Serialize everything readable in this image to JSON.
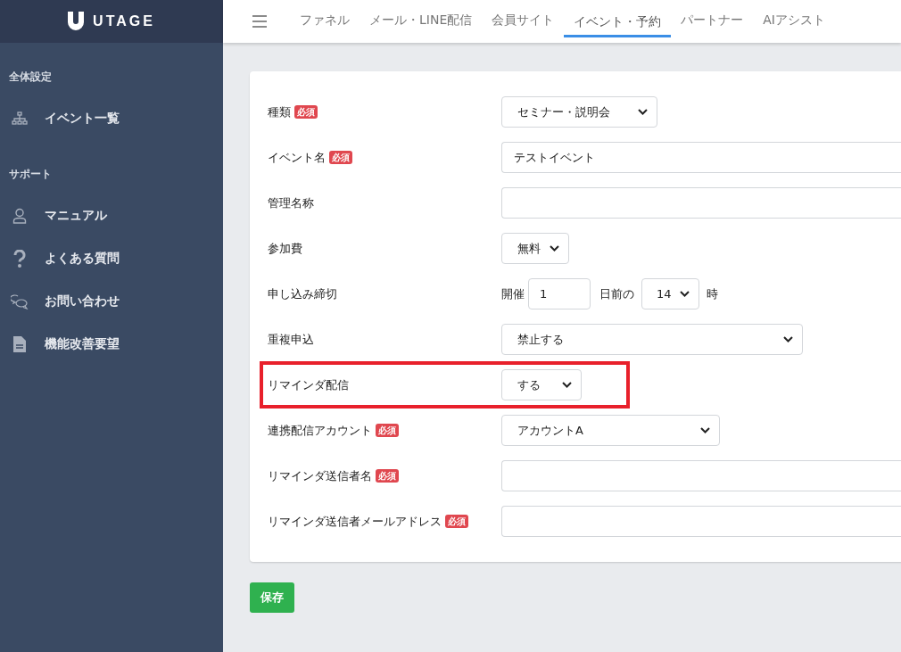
{
  "logo": {
    "text": "UTAGE"
  },
  "nav": {
    "tabs": [
      {
        "label": "ファネル",
        "selected": false
      },
      {
        "label": "メール・LINE配信",
        "selected": false
      },
      {
        "label": "会員サイト",
        "selected": false
      },
      {
        "label": "イベント・予約",
        "selected": true
      },
      {
        "label": "パートナー",
        "selected": false
      },
      {
        "label": "AIアシスト",
        "selected": false
      }
    ]
  },
  "sidebar": {
    "sections": [
      {
        "title": "全体設定",
        "items": [
          {
            "label": "イベント一覧"
          }
        ]
      },
      {
        "title": "サポート",
        "items": [
          {
            "label": "マニュアル"
          },
          {
            "label": "よくある質問"
          },
          {
            "label": "お問い合わせ"
          },
          {
            "label": "機能改善要望"
          }
        ]
      }
    ]
  },
  "form": {
    "fields": [
      {
        "label": "種類",
        "badge": "必須",
        "highlighted": false,
        "kind": "select",
        "value": "セミナー・説明会"
      },
      {
        "label": "イベント名",
        "badge": "必須",
        "highlighted": false,
        "kind": "text",
        "value": "テストイベント"
      },
      {
        "label": "管理名称",
        "highlighted": false,
        "kind": "text"
      },
      {
        "label": "参加費",
        "highlighted": false,
        "kind": "select",
        "value": "無料"
      },
      {
        "label": "申し込み締切",
        "highlighted": false,
        "kind": "deadline",
        "prefix": "開催",
        "days": "1",
        "middle": "日前の",
        "hour": "14",
        "suffix": "時"
      },
      {
        "label": "重複申込",
        "highlighted": false,
        "kind": "select",
        "value": "禁止する"
      },
      {
        "label": "リマインダ配信",
        "highlighted": true,
        "kind": "select",
        "value": "する"
      },
      {
        "label": "連携配信アカウント",
        "badge": "必須",
        "highlighted": false,
        "kind": "select",
        "value": "アカウントA"
      },
      {
        "label": "リマインダ送信者名",
        "badge": "必須",
        "highlighted": false,
        "kind": "text"
      },
      {
        "label": "リマインダ送信者メールアドレス",
        "badge": "必須",
        "highlighted": false,
        "kind": "text"
      }
    ]
  },
  "save_button": "保存"
}
